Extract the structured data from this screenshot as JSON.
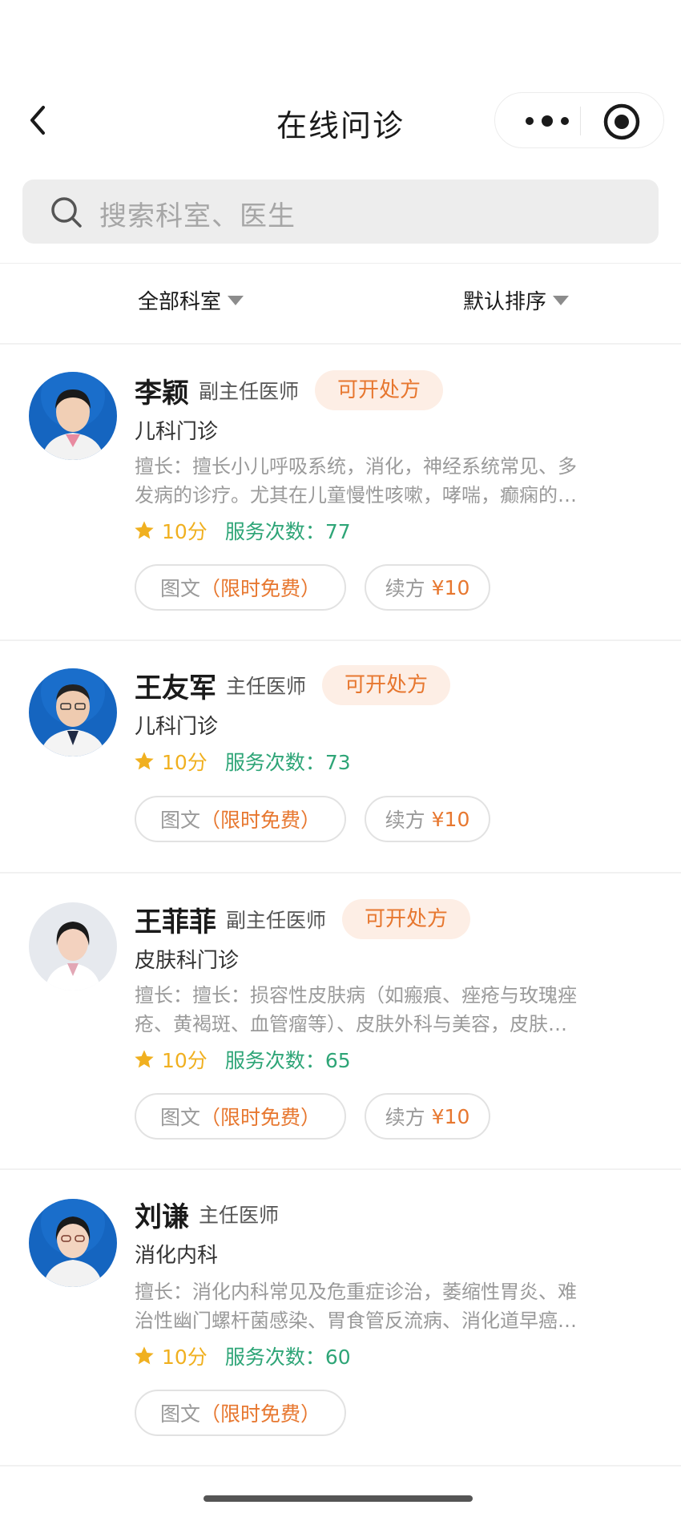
{
  "navbar": {
    "title": "在线问诊"
  },
  "search": {
    "placeholder": "搜索科室、医生"
  },
  "filters": {
    "department": "全部科室",
    "sort": "默认排序"
  },
  "doctors": [
    {
      "name": "李颖",
      "title": "副主任医师",
      "badge": "可开处方",
      "department": "儿科门诊",
      "desc_line1": "擅长：擅长小儿呼吸系统，消化，神经系统常见、多",
      "desc_line2": "发病的诊疗。尤其在儿童慢性咳嗽，哮喘，癫痫的…",
      "score": "10分",
      "service": "服务次数：77",
      "tuwen_label": "图文",
      "tuwen_price": "（限时免费）",
      "xufang_label": "续方",
      "xufang_price": "¥10",
      "avatar_bg": "#1565c0"
    },
    {
      "name": "王友军",
      "title": "主任医师",
      "badge": "可开处方",
      "department": "儿科门诊",
      "score": "10分",
      "service": "服务次数：73",
      "tuwen_label": "图文",
      "tuwen_price": "（限时免费）",
      "xufang_label": "续方",
      "xufang_price": "¥10",
      "avatar_bg": "#1565c0"
    },
    {
      "name": "王菲菲",
      "title": "副主任医师",
      "badge": "可开处方",
      "department": "皮肤科门诊",
      "desc_line1": "擅长：擅长：损容性皮肤病（如瘢痕、痤疮与玫瑰痤",
      "desc_line2": "疮、黄褐斑、血管瘤等）、皮肤外科与美容，皮肤…",
      "score": "10分",
      "service": "服务次数：65",
      "tuwen_label": "图文",
      "tuwen_price": "（限时免费）",
      "xufang_label": "续方",
      "xufang_price": "¥10",
      "avatar_bg": "#e6e9ee"
    },
    {
      "name": "刘谦",
      "title": "主任医师",
      "department": "消化内科",
      "desc_line1": "擅长：消化内科常见及危重症诊治，萎缩性胃炎、难",
      "desc_line2": "治性幽门螺杆菌感染、胃食管反流病、消化道早癌…",
      "score": "10分",
      "service": "服务次数：60",
      "tuwen_label": "图文",
      "tuwen_price": "（限时免费）",
      "avatar_bg": "#1565c0"
    }
  ],
  "colors": {
    "accent": "#e7772f",
    "badge_bg": "#fdeee5",
    "star": "#f0b020",
    "service": "#2ea577"
  },
  "icons": {
    "back": "chevron-left-icon",
    "more": "more-dots-icon",
    "target": "target-icon",
    "search": "search-icon",
    "star": "star-icon",
    "dropdown": "caret-down-icon"
  }
}
